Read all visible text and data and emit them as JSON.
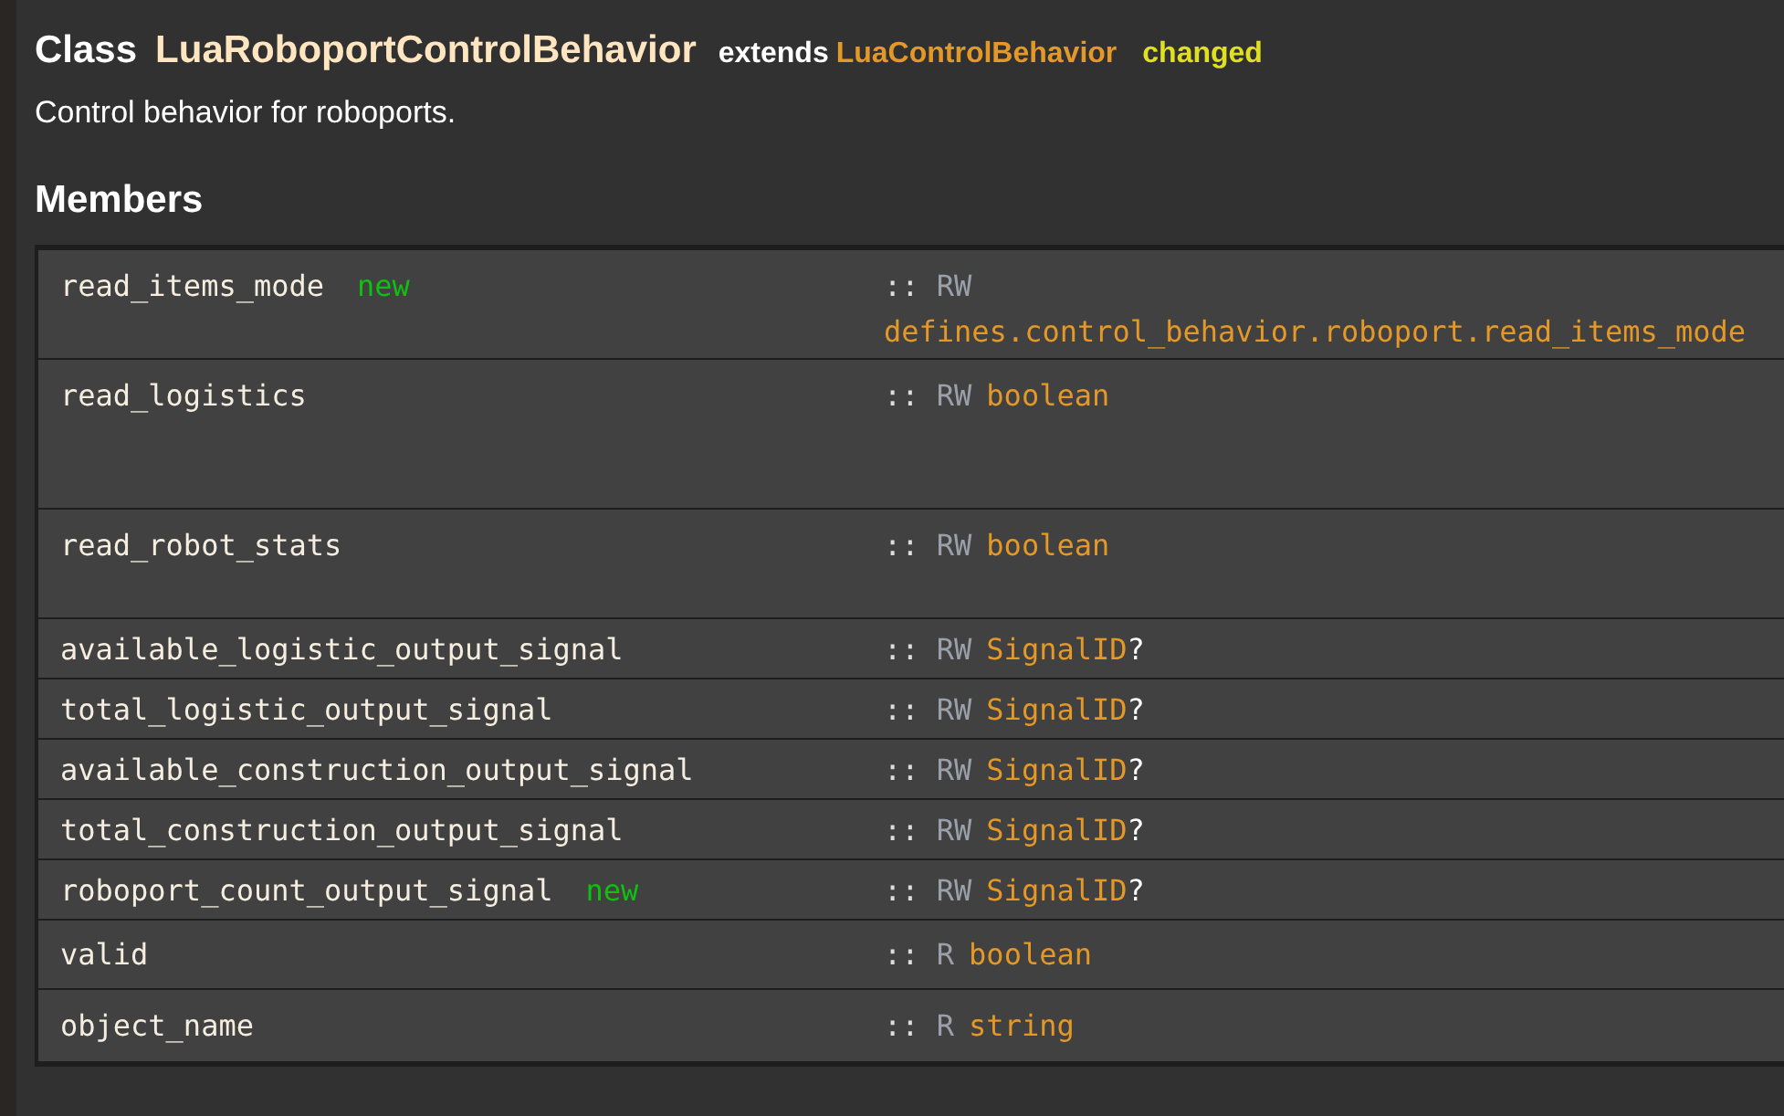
{
  "header": {
    "class_label": "Class",
    "class_name": "LuaRoboportControlBehavior",
    "extends_label": "extends",
    "parent": "LuaControlBehavior",
    "tag": "changed"
  },
  "description": "Control behavior for roboports.",
  "section_title": "Members",
  "members": [
    {
      "name": "read_items_mode",
      "badge": "new",
      "sep": "::",
      "access": "RW",
      "type": "defines.control_behavior.roboport.read_items_mode"
    },
    {
      "name": "read_logistics",
      "sep": "::",
      "access": "RW",
      "type": "boolean"
    },
    {
      "name": "read_robot_stats",
      "sep": "::",
      "access": "RW",
      "type": "boolean"
    },
    {
      "name": "available_logistic_output_signal",
      "sep": "::",
      "access": "RW",
      "type": "SignalID",
      "suffix": "?"
    },
    {
      "name": "total_logistic_output_signal",
      "sep": "::",
      "access": "RW",
      "type": "SignalID",
      "suffix": "?"
    },
    {
      "name": "available_construction_output_signal",
      "sep": "::",
      "access": "RW",
      "type": "SignalID",
      "suffix": "?"
    },
    {
      "name": "total_construction_output_signal",
      "sep": "::",
      "access": "RW",
      "type": "SignalID",
      "suffix": "?"
    },
    {
      "name": "roboport_count_output_signal",
      "badge": "new",
      "sep": "::",
      "access": "RW",
      "type": "SignalID",
      "suffix": "?"
    },
    {
      "name": "valid",
      "sep": "::",
      "access": "R",
      "type": "boolean"
    },
    {
      "name": "object_name",
      "sep": "::",
      "access": "R",
      "type": "string"
    }
  ]
}
